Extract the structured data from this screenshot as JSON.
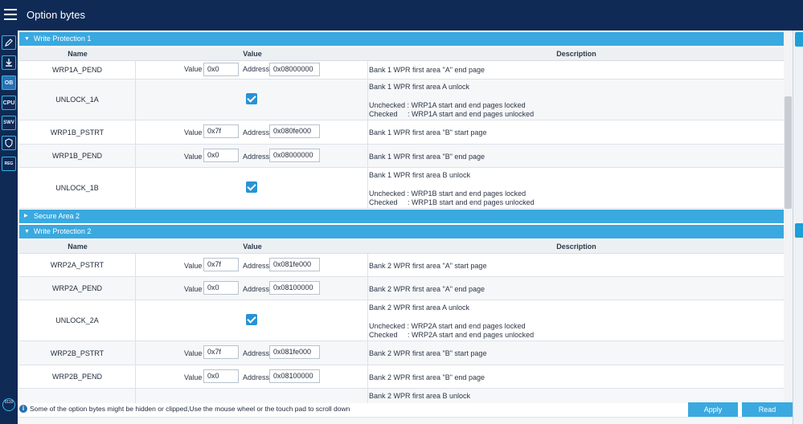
{
  "app": {
    "title": "Option bytes"
  },
  "rail": {
    "items": [
      {
        "icon": "edit-icon",
        "label": ""
      },
      {
        "icon": "download-icon",
        "label": ""
      },
      {
        "icon": "ob-icon",
        "label": "OB"
      },
      {
        "icon": "cpu-icon",
        "label": "CPU"
      },
      {
        "icon": "swv-icon",
        "label": "SWV"
      },
      {
        "icon": "shield-icon",
        "label": ""
      },
      {
        "icon": "reg-icon",
        "label": "REG"
      }
    ],
    "bottom_icon": "debug-icon",
    "bottom_label": "0110"
  },
  "sections": {
    "wp1": {
      "title": "Write Protection 1",
      "expanded": true
    },
    "secure2": {
      "title": "Secure Area 2",
      "expanded": false
    },
    "wp2": {
      "title": "Write Protection 2",
      "expanded": true
    }
  },
  "columns": {
    "name": "Name",
    "value": "Value",
    "description": "Description"
  },
  "labels": {
    "value": "Value",
    "address": "Address"
  },
  "wp1_rows": [
    {
      "name": "WRP1A_PEND",
      "value": "0x0",
      "address": "0x08000000",
      "desc": [
        "Bank 1 WPR first area \"A\" end page"
      ]
    },
    {
      "name": "UNLOCK_1A",
      "checked": true,
      "desc": [
        "Bank 1 WPR first area A unlock",
        "",
        "Unchecked : WRP1A start and end pages locked",
        "Checked     : WRP1A start and end pages unlocked"
      ]
    },
    {
      "name": "WRP1B_PSTRT",
      "value": "0x7f",
      "address": "0x080fe000",
      "desc": [
        "Bank 1 WPR first area \"B\" start page"
      ]
    },
    {
      "name": "WRP1B_PEND",
      "value": "0x0",
      "address": "0x08000000",
      "desc": [
        "Bank 1 WPR first area \"B\" end page"
      ]
    },
    {
      "name": "UNLOCK_1B",
      "checked": true,
      "desc": [
        "Bank 1 WPR first area B unlock",
        "",
        "Unchecked : WRP1B start and end pages locked",
        "Checked     : WRP1B start and end pages unlocked"
      ]
    }
  ],
  "wp2_rows": [
    {
      "name": "WRP2A_PSTRT",
      "value": "0x7f",
      "address": "0x081fe000",
      "desc": [
        "Bank 2 WPR first area \"A\" start page"
      ]
    },
    {
      "name": "WRP2A_PEND",
      "value": "0x0",
      "address": "0x08100000",
      "desc": [
        "Bank 2 WPR first area \"A\" end page"
      ]
    },
    {
      "name": "UNLOCK_2A",
      "checked": true,
      "desc": [
        "Bank 2 WPR first area A unlock",
        "",
        "Unchecked : WRP2A start and end pages locked",
        "Checked     : WRP2A start and end pages unlocked"
      ]
    },
    {
      "name": "WRP2B_PSTRT",
      "value": "0x7f",
      "address": "0x081fe000",
      "desc": [
        "Bank 2 WPR first area \"B\" start page"
      ]
    },
    {
      "name": "WRP2B_PEND",
      "value": "0x0",
      "address": "0x08100000",
      "desc": [
        "Bank 2 WPR first area \"B\" end page"
      ]
    },
    {
      "name": "",
      "desc": [
        "Bank 2 WPR first area B unlock"
      ]
    }
  ],
  "footer": {
    "info": "Some of the option bytes might be hidden or clipped,Use the mouse wheel or the touch pad to scroll down",
    "apply_label": "Apply",
    "read_label": "Read"
  },
  "colors": {
    "header_bg": "#0f2a55",
    "accent": "#3aa9e0",
    "checkbox": "#2793d6"
  }
}
